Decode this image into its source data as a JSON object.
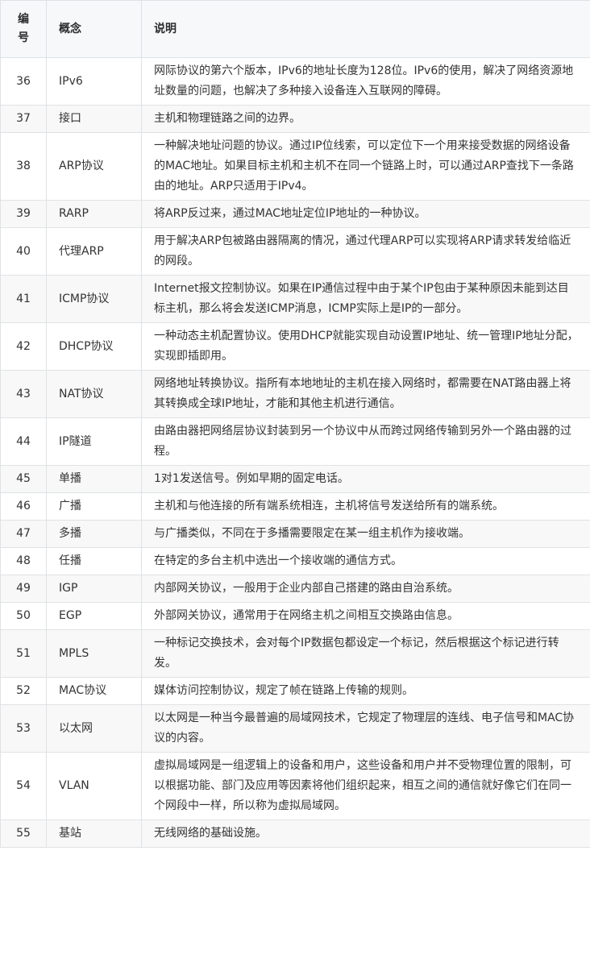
{
  "header": {
    "id": "编\n号",
    "concept": "概念",
    "desc": "说明"
  },
  "rows": [
    {
      "id": "36",
      "concept": "IPv6",
      "desc": "网际协议的第六个版本，IPv6的地址长度为128位。IPv6的使用，解决了网络资源地址数量的问题，也解决了多种接入设备连入互联网的障碍。"
    },
    {
      "id": "37",
      "concept": "接口",
      "desc": "主机和物理链路之间的边界。"
    },
    {
      "id": "38",
      "concept": "ARP协议",
      "desc": "一种解决地址问题的协议。通过IP位线索，可以定位下一个用来接受数据的网络设备的MAC地址。如果目标主机和主机不在同一个链路上时，可以通过ARP查找下一条路由的地址。ARP只适用于IPv4。"
    },
    {
      "id": "39",
      "concept": "RARP",
      "desc": "将ARP反过来，通过MAC地址定位IP地址的一种协议。"
    },
    {
      "id": "40",
      "concept": "代理ARP",
      "desc": "用于解决ARP包被路由器隔离的情况，通过代理ARP可以实现将ARP请求转发给临近的网段。"
    },
    {
      "id": "41",
      "concept": "ICMP协议",
      "desc": "Internet报文控制协议。如果在IP通信过程中由于某个IP包由于某种原因未能到达目标主机，那么将会发送ICMP消息，ICMP实际上是IP的一部分。"
    },
    {
      "id": "42",
      "concept": "DHCP协议",
      "desc": "一种动态主机配置协议。使用DHCP就能实现自动设置IP地址、统一管理IP地址分配，实现即插即用。"
    },
    {
      "id": "43",
      "concept": "NAT协议",
      "desc": "网络地址转换协议。指所有本地地址的主机在接入网络时，都需要在NAT路由器上将其转换成全球IP地址，才能和其他主机进行通信。"
    },
    {
      "id": "44",
      "concept": "IP隧道",
      "desc": "由路由器把网络层协议封装到另一个协议中从而跨过网络传输到另外一个路由器的过程。"
    },
    {
      "id": "45",
      "concept": "单播",
      "desc": "1对1发送信号。例如早期的固定电话。"
    },
    {
      "id": "46",
      "concept": "广播",
      "desc": "主机和与他连接的所有端系统相连，主机将信号发送给所有的端系统。"
    },
    {
      "id": "47",
      "concept": "多播",
      "desc": "与广播类似，不同在于多播需要限定在某一组主机作为接收端。"
    },
    {
      "id": "48",
      "concept": "任播",
      "desc": "在特定的多台主机中选出一个接收端的通信方式。"
    },
    {
      "id": "49",
      "concept": "IGP",
      "desc": "内部网关协议，一般用于企业内部自己搭建的路由自治系统。"
    },
    {
      "id": "50",
      "concept": "EGP",
      "desc": "外部网关协议，通常用于在网络主机之间相互交换路由信息。"
    },
    {
      "id": "51",
      "concept": "MPLS",
      "desc": "一种标记交换技术，会对每个IP数据包都设定一个标记，然后根据这个标记进行转发。"
    },
    {
      "id": "52",
      "concept": "MAC协议",
      "desc": "媒体访问控制协议，规定了帧在链路上传输的规则。"
    },
    {
      "id": "53",
      "concept": "以太网",
      "desc": "以太网是一种当今最普遍的局域网技术，它规定了物理层的连线、电子信号和MAC协议的内容。"
    },
    {
      "id": "54",
      "concept": "VLAN",
      "desc": "虚拟局域网是一组逻辑上的设备和用户，这些设备和用户并不受物理位置的限制，可以根据功能、部门及应用等因素将他们组织起来，相互之间的通信就好像它们在同一个网段中一样，所以称为虚拟局域网。"
    },
    {
      "id": "55",
      "concept": "基站",
      "desc": "无线网络的基础设施。"
    }
  ]
}
